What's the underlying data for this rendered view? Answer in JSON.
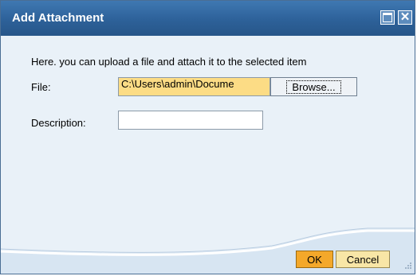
{
  "dialog": {
    "title": "Add Attachment",
    "intro_text": "Here. you can upload a file and attach it to the selected item"
  },
  "form": {
    "file_label": "File:",
    "file_value": "C:\\Users\\admin\\Docume",
    "browse_label": "Browse...",
    "description_label": "Description:",
    "description_value": ""
  },
  "buttons": {
    "ok_label": "OK",
    "cancel_label": "Cancel"
  },
  "icons": {
    "maximize": "maximize-icon",
    "close": "close-icon",
    "resize": "resize-grip-icon"
  },
  "colors": {
    "titlebar": "#2d6199",
    "panel": "#e9f1f8",
    "file_field": "#fcdc85",
    "ok_button": "#f4a82a",
    "cancel_button": "#f8e6a6"
  }
}
